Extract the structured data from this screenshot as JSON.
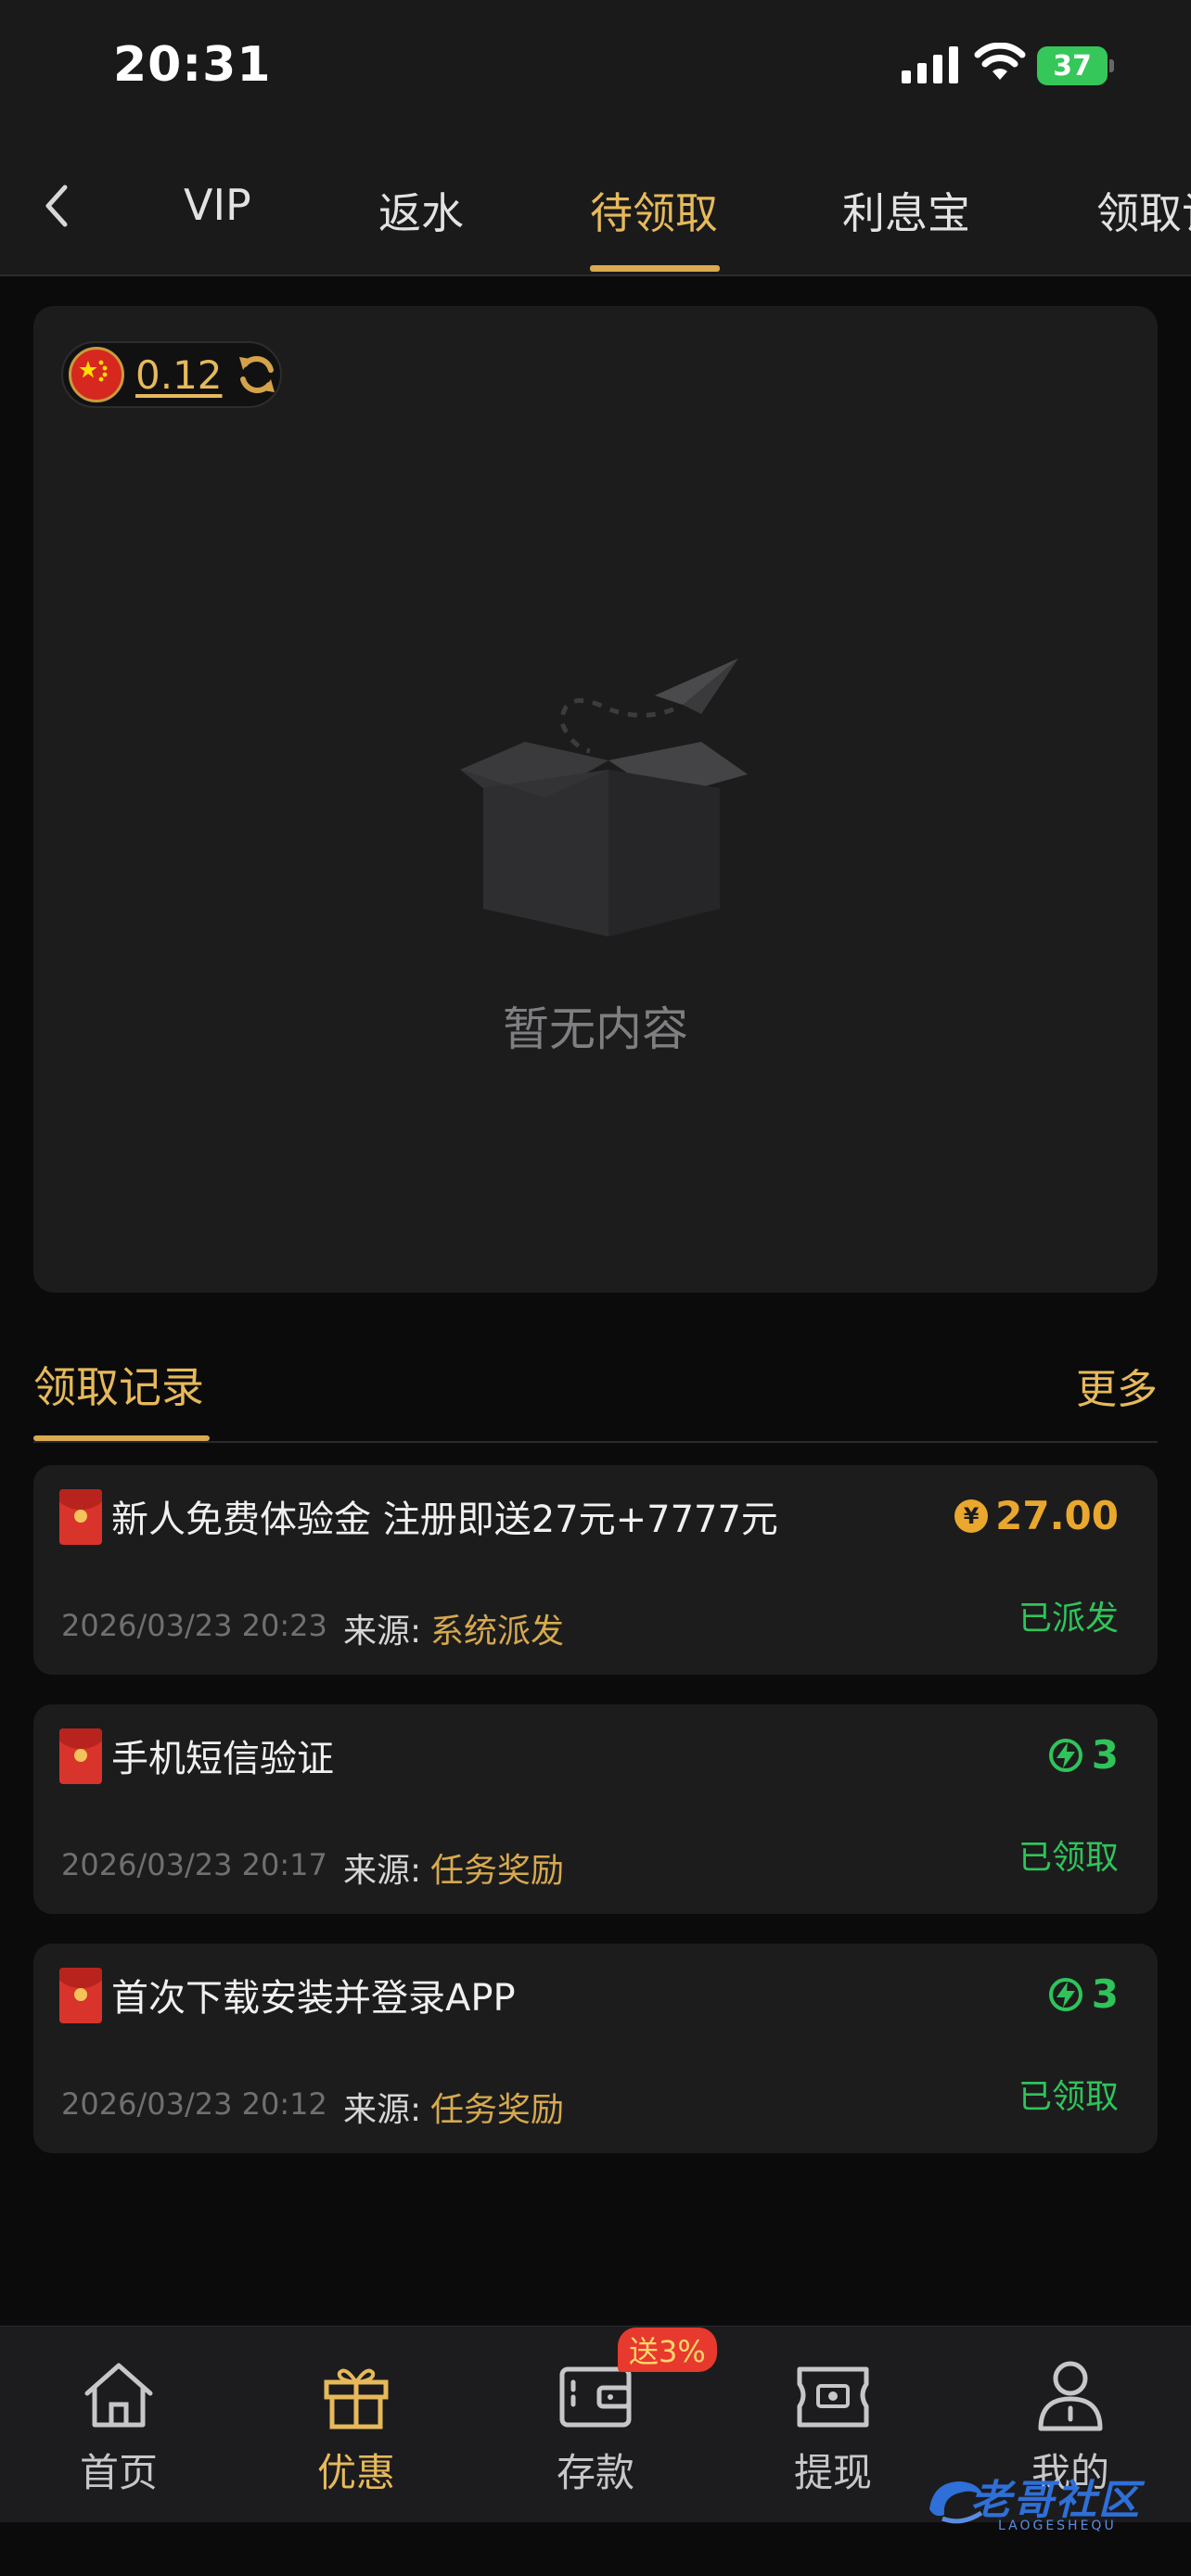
{
  "status_bar": {
    "time": "20:31",
    "battery": "37"
  },
  "nav": {
    "tabs": [
      "VIP",
      "返水",
      "待领取",
      "利息宝",
      "领取记录"
    ],
    "active_tab": "待领取"
  },
  "empty_card": {
    "balance": "0.12",
    "empty_text": "暂无内容"
  },
  "records": {
    "title": "领取记录",
    "more": "更多",
    "source_label": "来源:",
    "items": [
      {
        "title": "新人免费体验金 注册即送27元+7777元",
        "date": "2026/03/23 20:23",
        "source": "系统派发",
        "amount": "27.00",
        "amount_type": "yen",
        "status": "已派发"
      },
      {
        "title": "手机短信验证",
        "date": "2026/03/23 20:17",
        "source": "任务奖励",
        "amount": "3",
        "amount_type": "bolt",
        "status": "已领取"
      },
      {
        "title": "首次下载安装并登录APP",
        "date": "2026/03/23 20:12",
        "source": "任务奖励",
        "amount": "3",
        "amount_type": "bolt",
        "status": "已领取"
      }
    ]
  },
  "tabbar": {
    "items": [
      {
        "label": "首页",
        "icon": "home-icon"
      },
      {
        "label": "优惠",
        "icon": "gift-icon"
      },
      {
        "label": "存款",
        "icon": "wallet-icon"
      },
      {
        "label": "提现",
        "icon": "withdraw-icon"
      },
      {
        "label": "我的",
        "icon": "user-icon"
      }
    ],
    "active": "优惠",
    "deposit_badge": "送3%"
  },
  "watermark": {
    "text": "老哥社区",
    "sub": "LAOGESHEQU"
  },
  "colors": {
    "accent": "#e6b95a",
    "green": "#2fc45a",
    "card": "#1c1c1d",
    "background": "#0b0b0c"
  }
}
